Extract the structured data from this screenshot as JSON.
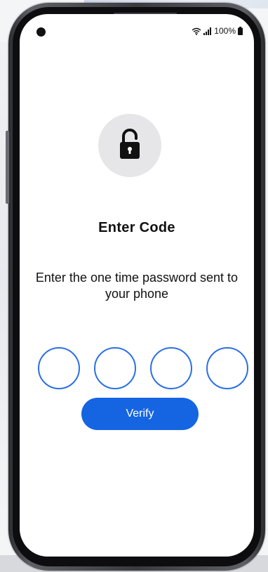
{
  "status_bar": {
    "battery_text": "100%"
  },
  "header": {
    "icon": "lock-icon",
    "title": "Enter Code",
    "subtitle": "Enter the one time password sent to your phone"
  },
  "otp": {
    "digits": [
      "",
      "",
      "",
      ""
    ]
  },
  "actions": {
    "verify_label": "Verify"
  },
  "colors": {
    "accent": "#1565e3",
    "otp_border": "#2b6fe6",
    "icon_bg": "#e6e6e8"
  }
}
